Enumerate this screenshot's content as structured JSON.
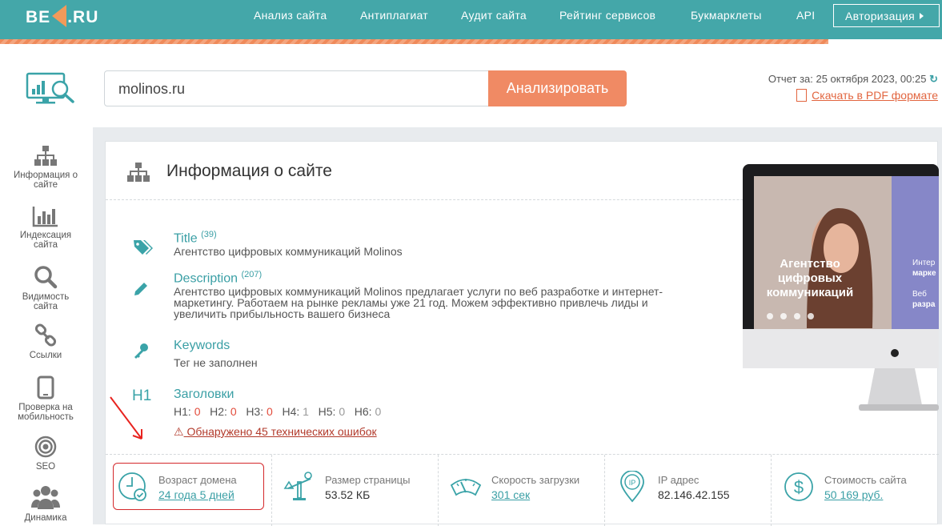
{
  "header": {
    "logo": {
      "left": "BE",
      "right": ".RU"
    },
    "nav": [
      "Анализ сайта",
      "Антиплагиат",
      "Аудит сайта",
      "Рейтинг сервисов",
      "Букмарклеты",
      "API"
    ],
    "auth_label": "Авторизация"
  },
  "search": {
    "value": "molinos.ru",
    "button_label": "Анализировать"
  },
  "report": {
    "date_text": "Отчет за: 25 октября 2023, 00:25",
    "pdf_link": "Скачать в PDF формате"
  },
  "sidebar": {
    "items": [
      {
        "label": "Информация о сайте",
        "icon": "sitemap-icon"
      },
      {
        "label": "Индексация сайта",
        "icon": "bar-chart-icon"
      },
      {
        "label": "Видимость сайта",
        "icon": "search-icon"
      },
      {
        "label": "Ссылки",
        "icon": "link-icon"
      },
      {
        "label": "Проверка на мобильность",
        "icon": "mobile-icon"
      },
      {
        "label": "SEO",
        "icon": "target-icon"
      },
      {
        "label": "Динамика",
        "icon": "users-icon"
      }
    ]
  },
  "card": {
    "title": "Информация о сайте",
    "title_row": {
      "label": "Title",
      "count": "(39)",
      "text": "Агентство цифровых коммуникаций Molinos"
    },
    "description_row": {
      "label": "Description",
      "count": "(207)",
      "text": "Агентство цифровых коммуникаций Molinos предлагает услуги по веб разработке и интернет-маркетингу. Работаем на рынке рекламы уже 21 год. Можем эффективно привлечь лиды и увеличить прибыльность вашего бизнеса"
    },
    "keywords_row": {
      "label": "Keywords",
      "text": "Тег не заполнен"
    },
    "headings_row": {
      "icon_text": "H1",
      "label": "Заголовки",
      "items": [
        {
          "name": "H1:",
          "value": "0"
        },
        {
          "name": "H2:",
          "value": "0"
        },
        {
          "name": "H3:",
          "value": "0"
        },
        {
          "name": "H4:",
          "value": "1"
        },
        {
          "name": "H5:",
          "value": "0"
        },
        {
          "name": "H6:",
          "value": "0"
        }
      ]
    },
    "errors_link": "Обнаружено 45 технических ошибок",
    "preview": {
      "headline": "Агентство цифровых коммуникаций",
      "side1": "Интер",
      "side2": "марке",
      "side3": "Веб",
      "side4": "разра"
    }
  },
  "stats": [
    {
      "label": "Возраст домена",
      "value": "24 года 5 дней",
      "icon": "clock-check-icon"
    },
    {
      "label": "Размер страницы",
      "value": "53.52 КБ",
      "icon": "scales-icon"
    },
    {
      "label": "Скорость загрузки",
      "value": "301 сек",
      "icon": "speedometer-icon"
    },
    {
      "label": "IP адрес",
      "value": "82.146.42.155",
      "icon": "ip-pin-icon"
    },
    {
      "label": "Стоимость сайта",
      "value": "50 169 руб.",
      "icon": "dollar-icon"
    }
  ],
  "colors": {
    "teal": "#44a7a9",
    "orange": "#f08a64",
    "link": "#3a9fa5",
    "error": "#b23a2b"
  }
}
